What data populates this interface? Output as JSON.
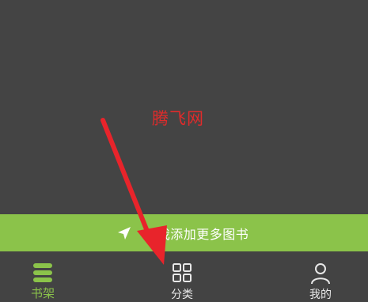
{
  "watermark": "腾飞网",
  "add_bar": {
    "icon": "navigation-arrow-icon",
    "label": "我添加更多图书"
  },
  "bottom_nav": {
    "items": [
      {
        "icon": "bookshelf-icon",
        "label": "书架",
        "active": true
      },
      {
        "icon": "grid-icon",
        "label": "分类",
        "active": false
      },
      {
        "icon": "user-icon",
        "label": "我的",
        "active": false
      }
    ]
  },
  "colors": {
    "accent": "#8bc34a",
    "background": "#444444",
    "annotation": "#e8242b"
  }
}
